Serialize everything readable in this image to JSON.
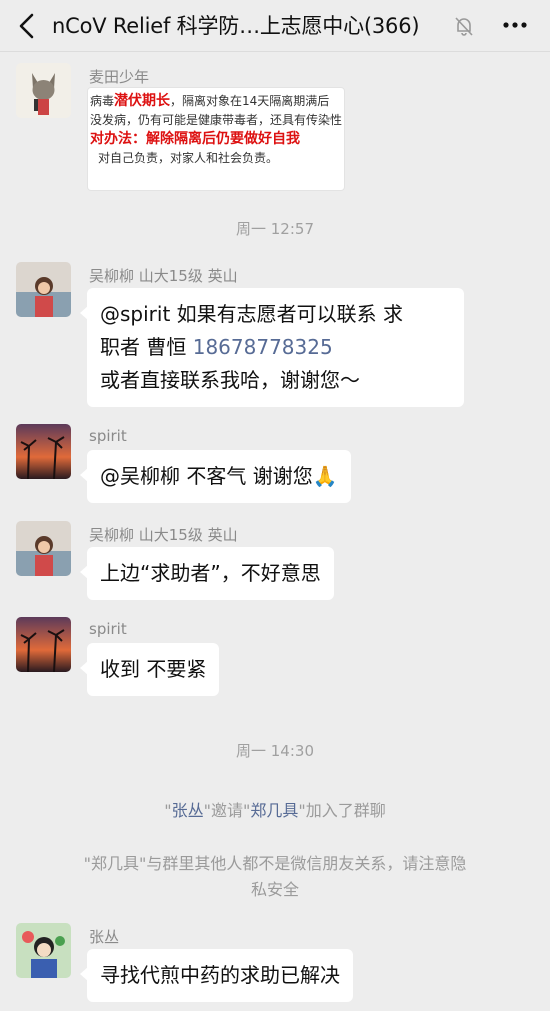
{
  "header": {
    "title": "nCoV Relief 科学防…上志愿中心(366)"
  },
  "messages": [
    {
      "sender": "麦田少年",
      "image_lines": [
        "病毒潜伏期长，隔离对象在14天隔离期满后",
        "没发病，仍有可能是健康带毒者，还具有传染性",
        "对办法：解除隔离后仍要做好自我",
        "对自己负责，对家人和社会负责。"
      ],
      "image_highlights": [
        "潜伏期长",
        "解除隔离后仍要做好自我"
      ]
    },
    {
      "time": "周一 12:57"
    },
    {
      "sender": "吴柳柳 山大15级 英山",
      "text_line1": "@spirit  如果有志愿者可以联系  求",
      "text_line2_prefix": "职者 曹恒 ",
      "phone": "18678778325",
      "text_line3": "或者直接联系我哈，谢谢您～"
    },
    {
      "sender": "spirit",
      "text": "@吴柳柳  不客气 谢谢您",
      "emoji": "🙏"
    },
    {
      "sender": "吴柳柳 山大15级 英山",
      "text": "上边“求助者”，不好意思"
    },
    {
      "sender": "spirit",
      "text": "收到 不要紧"
    },
    {
      "time": "周一 14:30"
    },
    {
      "system": true,
      "inviter": "张丛",
      "invite_word": "邀请",
      "invitee": "郑几具",
      "joined": "加入了群聊"
    },
    {
      "system": true,
      "notice_line1": "\"郑几具\"与群里其他人都不是微信朋友关系，请注意隐",
      "notice_line2": "私安全"
    },
    {
      "sender": "张丛",
      "text": "寻找代煎中药的求助已解决"
    }
  ]
}
